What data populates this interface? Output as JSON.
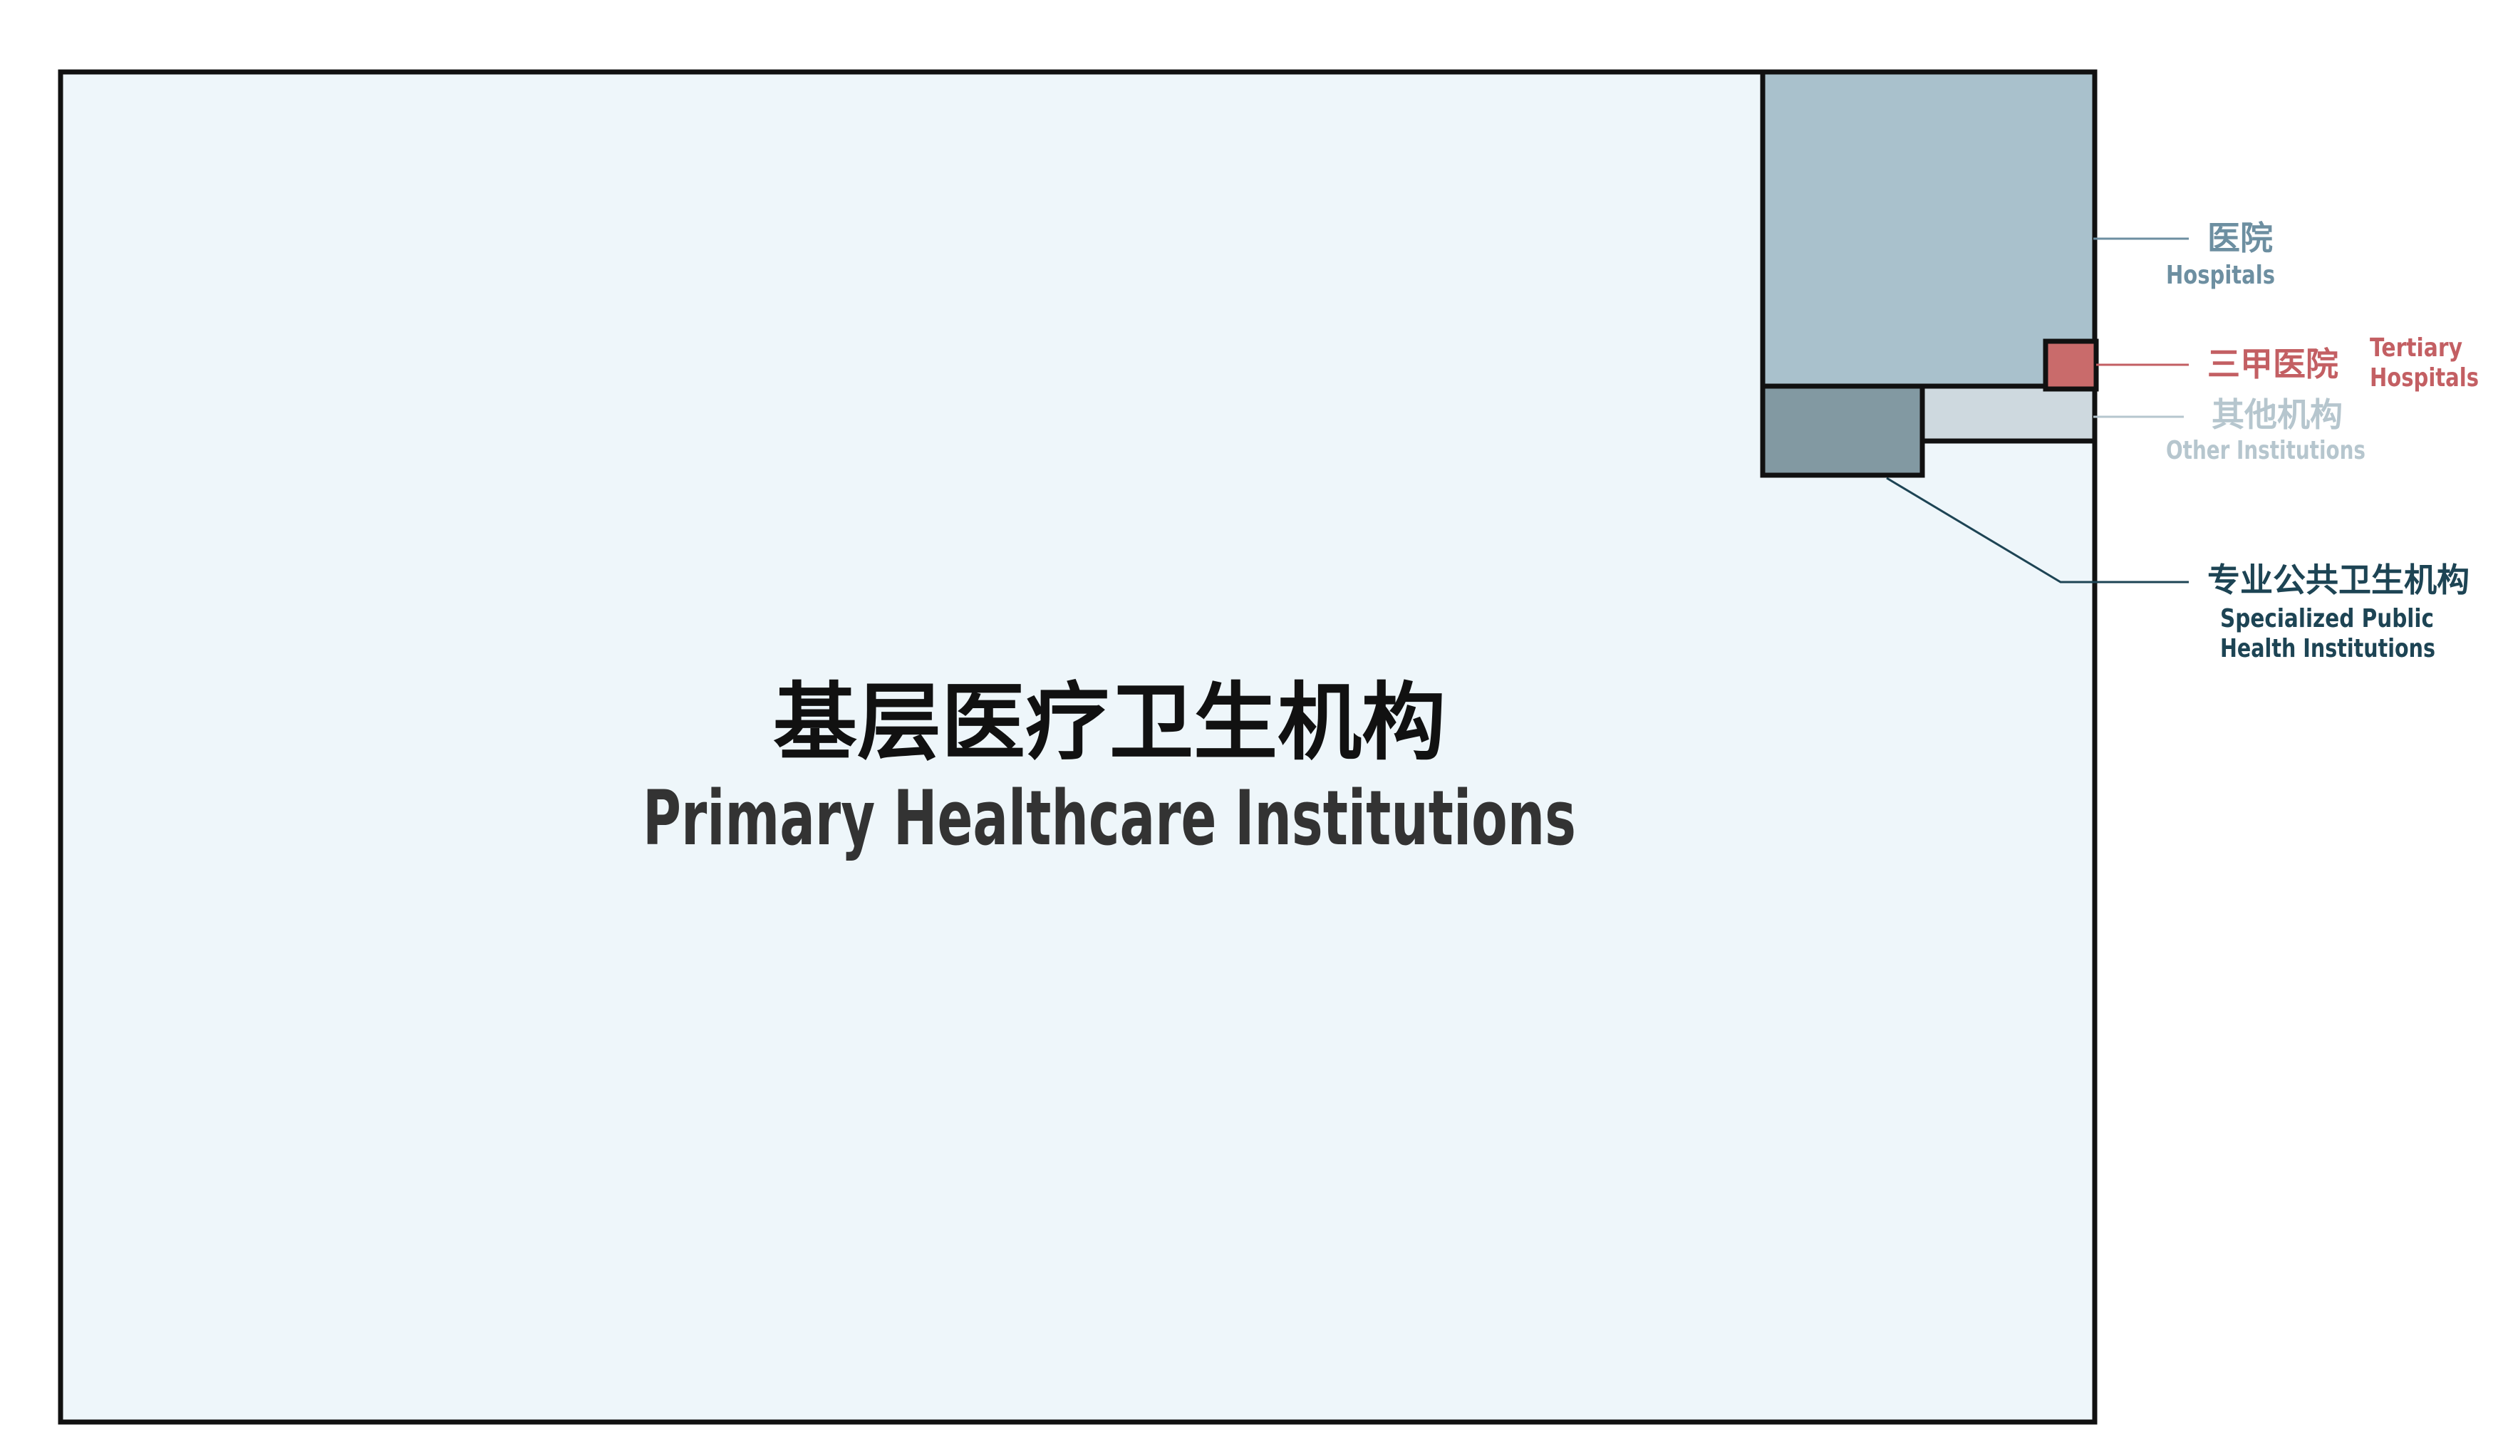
{
  "main": {
    "label_zh": "基层医疗卫生机构",
    "label_en": "Primary Healthcare Institutions"
  },
  "legend": {
    "hospitals": {
      "label_zh": "医院",
      "label_en": "Hospitals"
    },
    "tertiary": {
      "label_zh": "三甲医院",
      "label_en_line1": "Tertiary",
      "label_en_line2": "Hospitals"
    },
    "other": {
      "label_zh": "其他机构",
      "label_en": "Other Institutions"
    },
    "specialized": {
      "label_zh": "专业公共卫生机构",
      "label_en_line1": "Specialized Public",
      "label_en_line2": "Health Institutions"
    }
  },
  "colors": {
    "primary_fill": "#eef6fa",
    "hospitals_fill": "#a9c1cc",
    "hospitals_text": "#6d8fa1",
    "tertiary_fill": "#c96b6b",
    "tertiary_text": "#c35f63",
    "other_fill": "#ced9df",
    "other_text": "#b6c6ce",
    "specialized_fill": "#8299a2",
    "specialized_text": "#1d4454",
    "main_zh_text": "#111111",
    "main_en_text": "#333333",
    "border": "#111111"
  }
}
